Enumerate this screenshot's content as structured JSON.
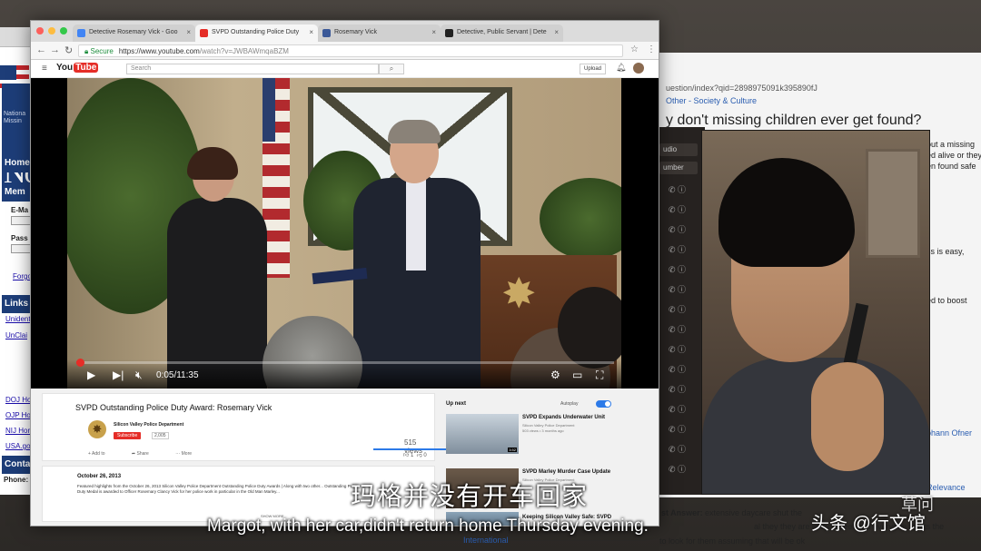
{
  "browser": {
    "tabs": [
      {
        "label": "Detective Rosemary Vick - Goo",
        "favicon_color": "#4285f4"
      },
      {
        "label": "SVPD Outstanding Police Duty",
        "favicon_color": "#e52d27"
      },
      {
        "label": "Rosemary Vick",
        "favicon_color": "#3b5998"
      },
      {
        "label": "Detective, Public Servant | Dete",
        "favicon_color": "#222222"
      }
    ],
    "secure_label": "Secure",
    "url_host": "https://www.youtube.com",
    "url_path": "/watch?v=JWBAWmqaBZM"
  },
  "youtube": {
    "search_placeholder": "Search",
    "upload_label": "Upload",
    "video": {
      "title": "SVPD Outstanding Police Duty Award: Rosemary Vick",
      "time_current": "0:05",
      "time_total": "11:35",
      "time_display": "0:05/11:35",
      "progress_fraction": 0.007,
      "channel": "Silicon Valley Police Department",
      "subscribe_label": "Subscribe",
      "subscriber_count": "2,005",
      "views": "515 views",
      "likes": "1",
      "dislikes": "0",
      "actions": [
        "Add to",
        "Share",
        "More"
      ],
      "description_date": "October 26, 2013",
      "description": "Featured highlights from the October 26, 2013 Silicon Valley Police Department Outstanding Police Duty Awards | Along with two other... Outstanding Police Duty Medal is awarded to Officer Rosemary Clancy Vick for her police work   in particular in the Old Man Marley...",
      "show_more": "SHOW MORE"
    },
    "up_next": {
      "label": "Up next",
      "autoplay_label": "Autoplay",
      "autoplay_on": true,
      "items": [
        {
          "title": "SVPD Expands Underwater Unit",
          "channel": "Silicon Valley Police Department",
          "meta": "503 views • 3 months ago",
          "duration": "3:52"
        },
        {
          "title": "SVPD Marley Murder Case Update",
          "channel": "Silicon Valley Police Department",
          "meta": "",
          "duration": ""
        },
        {
          "title": "Keeping Silicon Valley Safe: SVPD",
          "channel": "",
          "meta": "",
          "duration": ""
        }
      ]
    }
  },
  "back_left": {
    "nav_home": "Home",
    "nav_members": "Mem",
    "label_email": "E-Ma",
    "label_pass": "Pass",
    "link_forgot": "Forgo",
    "nav_links": "Links",
    "links": [
      "Unident",
      "UnClai",
      "DOJ Ho",
      "OJP Ho",
      "NIJ Hor",
      "USA.go"
    ],
    "nav_contact": "Conta",
    "phone": "Phone:"
  },
  "back_right": {
    "url": "uestion/index?qid=2898975091k395890fJ",
    "crumb": "Other - Society & Culture",
    "question": "y don't missing children ever get found?",
    "snippets": [
      "out a missing",
      "ed alive or they",
      "en found safe",
      "ss is easy,",
      "ed to boost",
      "ohann Ofner",
      "Relevance"
    ],
    "answer_label": "st Answer:",
    "answer_line1": "extensive daycare shut the",
    "answer_line2": "al they they are in the street and everyone thinks the",
    "answer_line3": "to look for them assuming that will be ok",
    "category": "International"
  },
  "side_panel": {
    "head1": "udio",
    "head2": "umber"
  },
  "subtitles": {
    "chinese": "玛格并没有开车回家",
    "english": "Margot, with her car,didn't return home Thursday evening."
  },
  "watermark": {
    "text": "头条 @行文馆",
    "small": "草问"
  }
}
